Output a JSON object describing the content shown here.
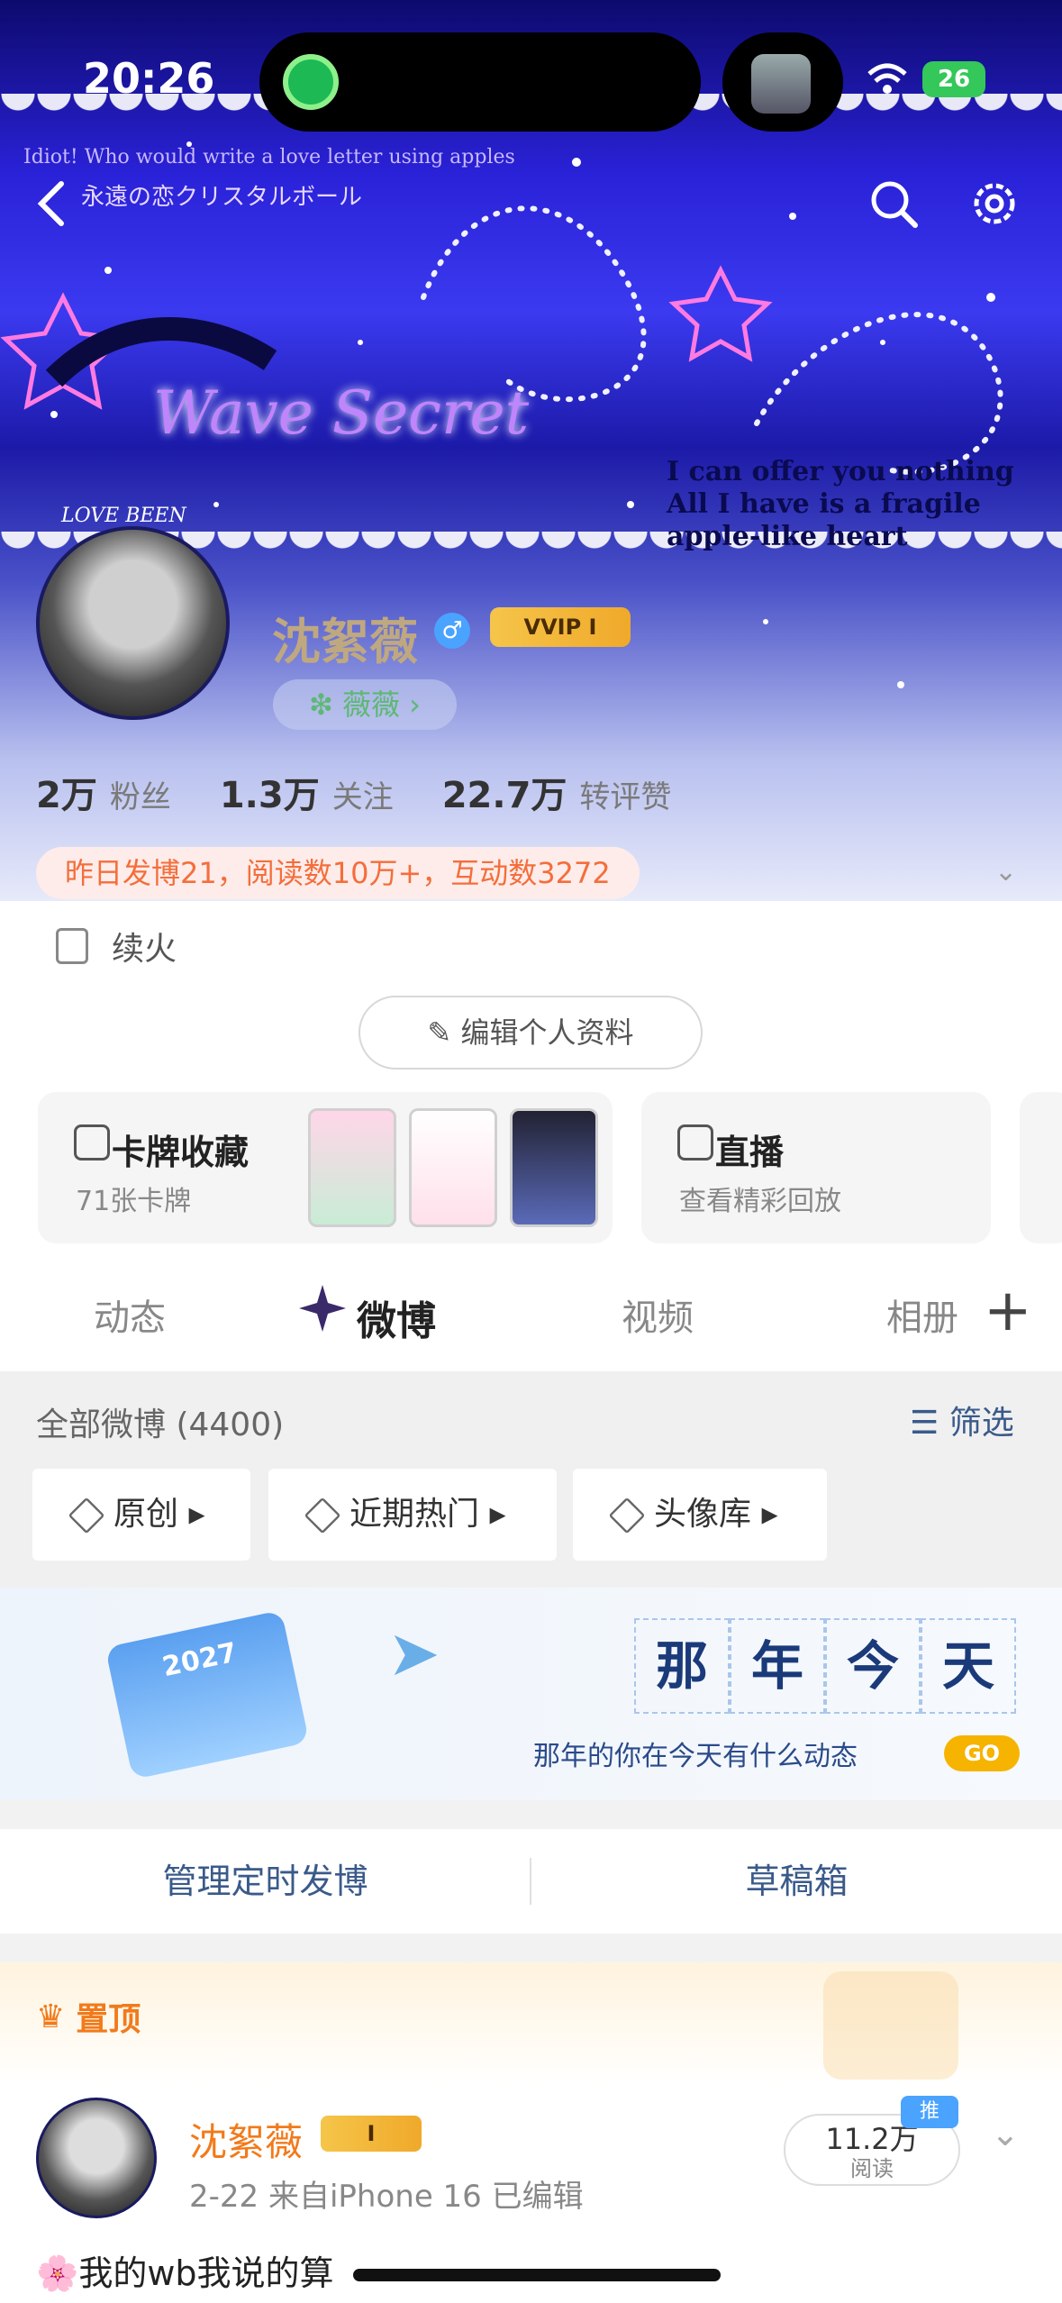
{
  "status": {
    "time": "20:26",
    "battery": "26"
  },
  "hero": {
    "tagline": "Idiot! Who would write a love letter using apples",
    "jp_title": "永遠の恋クリスタルボール",
    "art_title": "Wave Secret",
    "quote_line1": "I can offer you nothing",
    "quote_line2": "All I have is a fragile apple-like heart",
    "avatar_text": "LOVE BEEN"
  },
  "profile": {
    "name": "沈絮薇",
    "vip_label": "VVIP I",
    "pill_label": "❇ 薇薇 ›",
    "stats": [
      {
        "num": "2万",
        "label": "粉丝"
      },
      {
        "num": "1.3万",
        "label": "关注"
      },
      {
        "num": "22.7万",
        "label": "转评赞"
      }
    ],
    "activity": "昨日发博21，阅读数10万+，互动数3272",
    "bio": "续火",
    "edit_button": "编辑个人资料"
  },
  "cards": {
    "collect_title": "卡牌收藏",
    "collect_sub": "71张卡牌",
    "live_title": "直播",
    "live_sub": "查看精彩回放"
  },
  "tabs": [
    "动态",
    "微博",
    "视频",
    "相册"
  ],
  "feed": {
    "all_label": "全部微博 (4400)",
    "filter_label": "筛选",
    "chips": [
      "原创",
      "近期热门",
      "头像库"
    ]
  },
  "banner": {
    "chars": [
      "那",
      "年",
      "今",
      "天"
    ],
    "subtitle": "那年的你在今天有什么动态",
    "go": "GO",
    "calendar_year": "2027"
  },
  "actions": {
    "scheduled": "管理定时发博",
    "drafts": "草稿箱"
  },
  "post": {
    "pinned_label": "置顶",
    "author": "沈絮薇",
    "badge": "I",
    "meta": "2-22  来自iPhone 16  已编辑",
    "reads": "11.2万",
    "reads_label": "阅读",
    "promo_tag": "推广",
    "text": "🌸我的wb我说的算"
  },
  "colors": {
    "accent": "#f27a1a",
    "link": "#3a5a8a",
    "vip_gold": "#f5c54a"
  }
}
